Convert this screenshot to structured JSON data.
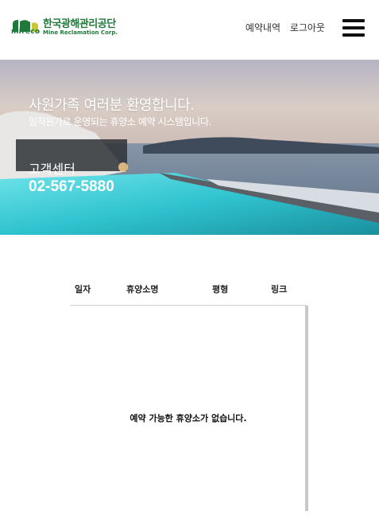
{
  "header": {
    "logo": {
      "brand_mark_text": "mireco",
      "korean_name": "한국광해관리공단",
      "english_name": "Mine Reclamation Corp."
    },
    "nav": {
      "reservations_label": "예약내역",
      "logout_label": "로그아웃"
    }
  },
  "hero": {
    "title": "사원가족 여러분 환영합니다.",
    "subtitle": "임직원가로 운영되는 휴양소 예약 시스템입니다.",
    "customer_center_label": "고객센터",
    "phone": "02-567-5880"
  },
  "table": {
    "columns": [
      "일자",
      "휴양소명",
      "평형",
      "링크"
    ],
    "rows": [],
    "empty_message": "예약 가능한 휴양소가 없습니다."
  },
  "colors": {
    "brand_green": "#1f7a3a",
    "hamburger": "#111111"
  }
}
